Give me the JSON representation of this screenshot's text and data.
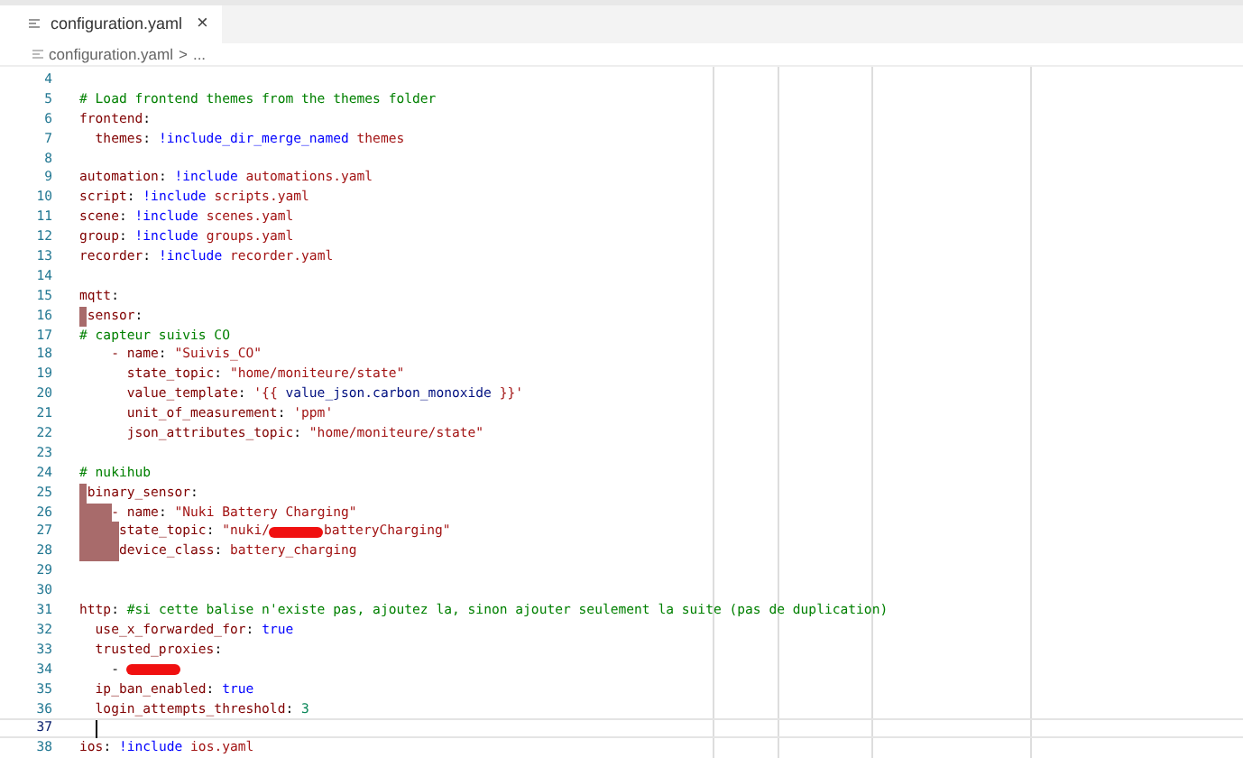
{
  "tabs": [
    {
      "label": "configuration.yaml",
      "close": "×",
      "selected": true
    }
  ],
  "breadcrumb": {
    "file": "configuration.yaml",
    "separator": ">",
    "rest": "..."
  },
  "lines": [
    {
      "number": "4"
    },
    {
      "number": "5",
      "segments": [
        {
          "text": "# Load frontend themes from the themes folder",
          "kind": "comment"
        }
      ]
    },
    {
      "number": "6",
      "segments": [
        {
          "text": "frontend",
          "kind": "key"
        },
        {
          "text": ":",
          "kind": "punct"
        }
      ]
    },
    {
      "number": "7",
      "segments": [
        {
          "kind": "space"
        },
        {
          "kind": "space"
        },
        {
          "text": "themes",
          "kind": "key"
        },
        {
          "text": ":",
          "kind": "punct"
        },
        {
          "kind": "space"
        },
        {
          "text": "!include_dir_merge_named",
          "kind": "tag"
        },
        {
          "kind": "space"
        },
        {
          "text": "themes",
          "kind": "value"
        }
      ]
    },
    {
      "number": "8"
    },
    {
      "number": "9",
      "segments": [
        {
          "text": "automation",
          "kind": "key"
        },
        {
          "text": ":",
          "kind": "punct"
        },
        {
          "kind": "space"
        },
        {
          "text": "!include",
          "kind": "tag"
        },
        {
          "kind": "space"
        },
        {
          "text": "automations.yaml",
          "kind": "value"
        }
      ]
    },
    {
      "number": "10",
      "segments": [
        {
          "text": "script",
          "kind": "key"
        },
        {
          "text": ":",
          "kind": "punct"
        },
        {
          "kind": "space"
        },
        {
          "text": "!include",
          "kind": "tag"
        },
        {
          "kind": "space"
        },
        {
          "text": "scripts.yaml",
          "kind": "value"
        }
      ]
    },
    {
      "number": "11",
      "segments": [
        {
          "text": "scene",
          "kind": "key"
        },
        {
          "text": ":",
          "kind": "punct"
        },
        {
          "kind": "space"
        },
        {
          "text": "!include",
          "kind": "tag"
        },
        {
          "kind": "space"
        },
        {
          "text": "scenes.yaml",
          "kind": "value"
        }
      ]
    },
    {
      "number": "12",
      "segments": [
        {
          "text": "group",
          "kind": "key"
        },
        {
          "text": ":",
          "kind": "punct"
        },
        {
          "kind": "space"
        },
        {
          "text": "!include",
          "kind": "tag"
        },
        {
          "kind": "space"
        },
        {
          "text": "groups.yaml",
          "kind": "value"
        }
      ]
    },
    {
      "number": "13",
      "segments": [
        {
          "text": "recorder",
          "kind": "key"
        },
        {
          "text": ":",
          "kind": "punct"
        },
        {
          "kind": "space"
        },
        {
          "text": "!include",
          "kind": "tag"
        },
        {
          "kind": "space"
        },
        {
          "text": "recorder.yaml",
          "kind": "value"
        }
      ]
    },
    {
      "number": "14"
    },
    {
      "number": "15",
      "segments": [
        {
          "text": "mqtt",
          "kind": "key"
        },
        {
          "text": ":",
          "kind": "punct"
        }
      ]
    },
    {
      "number": "16",
      "segments": [
        {
          "kind": "error"
        },
        {
          "text": "sensor",
          "kind": "key"
        },
        {
          "text": ":",
          "kind": "punct"
        }
      ]
    },
    {
      "number": "17",
      "segments": [
        {
          "text": "# capteur suivis CO",
          "kind": "comment"
        }
      ]
    },
    {
      "number": "18",
      "segments": [
        {
          "kind": "space"
        },
        {
          "kind": "space"
        },
        {
          "kind": "space"
        },
        {
          "kind": "space"
        },
        {
          "text": "- name",
          "kind": "key"
        },
        {
          "text": ":",
          "kind": "punct"
        },
        {
          "kind": "space"
        },
        {
          "text": "\"Suivis_CO\"",
          "kind": "value"
        }
      ]
    },
    {
      "number": "19",
      "segments": [
        {
          "kind": "space"
        },
        {
          "kind": "space"
        },
        {
          "kind": "space"
        },
        {
          "kind": "space"
        },
        {
          "kind": "space"
        },
        {
          "kind": "space"
        },
        {
          "text": "state_topic",
          "kind": "key"
        },
        {
          "text": ":",
          "kind": "punct"
        },
        {
          "kind": "space"
        },
        {
          "text": "\"home/moniteure/state\"",
          "kind": "value"
        }
      ]
    },
    {
      "number": "20",
      "segments": [
        {
          "kind": "space"
        },
        {
          "kind": "space"
        },
        {
          "kind": "space"
        },
        {
          "kind": "space"
        },
        {
          "kind": "space"
        },
        {
          "kind": "space"
        },
        {
          "text": "value_template",
          "kind": "key"
        },
        {
          "text": ":",
          "kind": "punct"
        },
        {
          "kind": "space"
        },
        {
          "text": "'{{",
          "kind": "value"
        },
        {
          "kind": "space"
        },
        {
          "text": "value_json.carbon_monoxide",
          "kind": "template"
        },
        {
          "kind": "space"
        },
        {
          "text": "}}'",
          "kind": "value"
        }
      ]
    },
    {
      "number": "21",
      "segments": [
        {
          "kind": "space"
        },
        {
          "kind": "space"
        },
        {
          "kind": "space"
        },
        {
          "kind": "space"
        },
        {
          "kind": "space"
        },
        {
          "kind": "space"
        },
        {
          "text": "unit_of_measurement",
          "kind": "key"
        },
        {
          "text": ":",
          "kind": "punct"
        },
        {
          "kind": "space"
        },
        {
          "text": "'ppm'",
          "kind": "value"
        }
      ]
    },
    {
      "number": "22",
      "segments": [
        {
          "kind": "space"
        },
        {
          "kind": "space"
        },
        {
          "kind": "space"
        },
        {
          "kind": "space"
        },
        {
          "kind": "space"
        },
        {
          "kind": "space"
        },
        {
          "text": "json_attributes_topic",
          "kind": "key"
        },
        {
          "text": ":",
          "kind": "punct"
        },
        {
          "kind": "space"
        },
        {
          "text": "\"home/moniteure/state\"",
          "kind": "value"
        }
      ]
    },
    {
      "number": "23"
    },
    {
      "number": "24",
      "segments": [
        {
          "text": "# nukihub",
          "kind": "comment"
        }
      ]
    },
    {
      "number": "25",
      "segments": [
        {
          "kind": "error"
        },
        {
          "text": "binary_sensor",
          "kind": "key"
        },
        {
          "text": ":",
          "kind": "punct"
        }
      ]
    },
    {
      "number": "26",
      "segments": [
        {
          "kind": "error"
        },
        {
          "kind": "error"
        },
        {
          "kind": "error"
        },
        {
          "kind": "error"
        },
        {
          "text": "- name",
          "kind": "key"
        },
        {
          "text": ":",
          "kind": "punct"
        },
        {
          "kind": "space"
        },
        {
          "text": "\"Nuki Battery Charging\"",
          "kind": "value"
        }
      ]
    },
    {
      "number": "27",
      "segments": [
        {
          "kind": "error"
        },
        {
          "kind": "error"
        },
        {
          "kind": "error"
        },
        {
          "kind": "error"
        },
        {
          "kind": "error"
        },
        {
          "text": "state_topic",
          "kind": "key"
        },
        {
          "text": ":",
          "kind": "punct"
        },
        {
          "kind": "space"
        },
        {
          "text": "\"nuki/",
          "kind": "value"
        },
        {
          "kind": "redaction"
        },
        {
          "text": "batteryCharging\"",
          "kind": "value"
        }
      ]
    },
    {
      "number": "28",
      "segments": [
        {
          "kind": "error"
        },
        {
          "kind": "error"
        },
        {
          "kind": "error"
        },
        {
          "kind": "error"
        },
        {
          "kind": "error"
        },
        {
          "text": "device_class",
          "kind": "key"
        },
        {
          "text": ":",
          "kind": "punct"
        },
        {
          "kind": "space"
        },
        {
          "text": "battery_charging",
          "kind": "value"
        }
      ]
    },
    {
      "number": "29"
    },
    {
      "number": "30"
    },
    {
      "number": "31",
      "segments": [
        {
          "text": "http",
          "kind": "key"
        },
        {
          "text": ":",
          "kind": "punct"
        },
        {
          "kind": "space"
        },
        {
          "text": "#si cette balise n'existe pas, ajoutez la, sinon ajouter seulement la suite (pas de duplication)",
          "kind": "comment"
        }
      ]
    },
    {
      "number": "32",
      "segments": [
        {
          "kind": "space"
        },
        {
          "kind": "space"
        },
        {
          "text": "use_x_forwarded_for",
          "kind": "key"
        },
        {
          "text": ":",
          "kind": "punct"
        },
        {
          "kind": "space"
        },
        {
          "text": "true",
          "kind": "bool"
        }
      ]
    },
    {
      "number": "33",
      "segments": [
        {
          "kind": "space"
        },
        {
          "kind": "space"
        },
        {
          "text": "trusted_proxies",
          "kind": "key"
        },
        {
          "text": ":",
          "kind": "punct"
        }
      ]
    },
    {
      "number": "34",
      "segments": [
        {
          "kind": "space"
        },
        {
          "kind": "space"
        },
        {
          "kind": "space"
        },
        {
          "kind": "space"
        },
        {
          "text": "-",
          "kind": "punct"
        },
        {
          "kind": "space"
        },
        {
          "kind": "redaction"
        }
      ]
    },
    {
      "number": "35",
      "segments": [
        {
          "kind": "space"
        },
        {
          "kind": "space"
        },
        {
          "text": "ip_ban_enabled",
          "kind": "key"
        },
        {
          "text": ":",
          "kind": "punct"
        },
        {
          "kind": "space"
        },
        {
          "text": "true",
          "kind": "bool"
        }
      ]
    },
    {
      "number": "36",
      "segments": [
        {
          "kind": "space"
        },
        {
          "kind": "space"
        },
        {
          "text": "login_attempts_threshold",
          "kind": "key"
        },
        {
          "text": ":",
          "kind": "punct"
        },
        {
          "kind": "space"
        },
        {
          "text": "3",
          "kind": "number"
        }
      ]
    },
    {
      "number": "37",
      "current": true,
      "segments": [
        {
          "kind": "space"
        },
        {
          "kind": "space"
        }
      ]
    },
    {
      "number": "38",
      "segments": [
        {
          "text": "ios",
          "kind": "key"
        },
        {
          "text": ":",
          "kind": "punct"
        },
        {
          "kind": "space"
        },
        {
          "text": "!include",
          "kind": "tag"
        },
        {
          "kind": "space"
        },
        {
          "text": "ios.yaml",
          "kind": "value"
        }
      ]
    }
  ]
}
